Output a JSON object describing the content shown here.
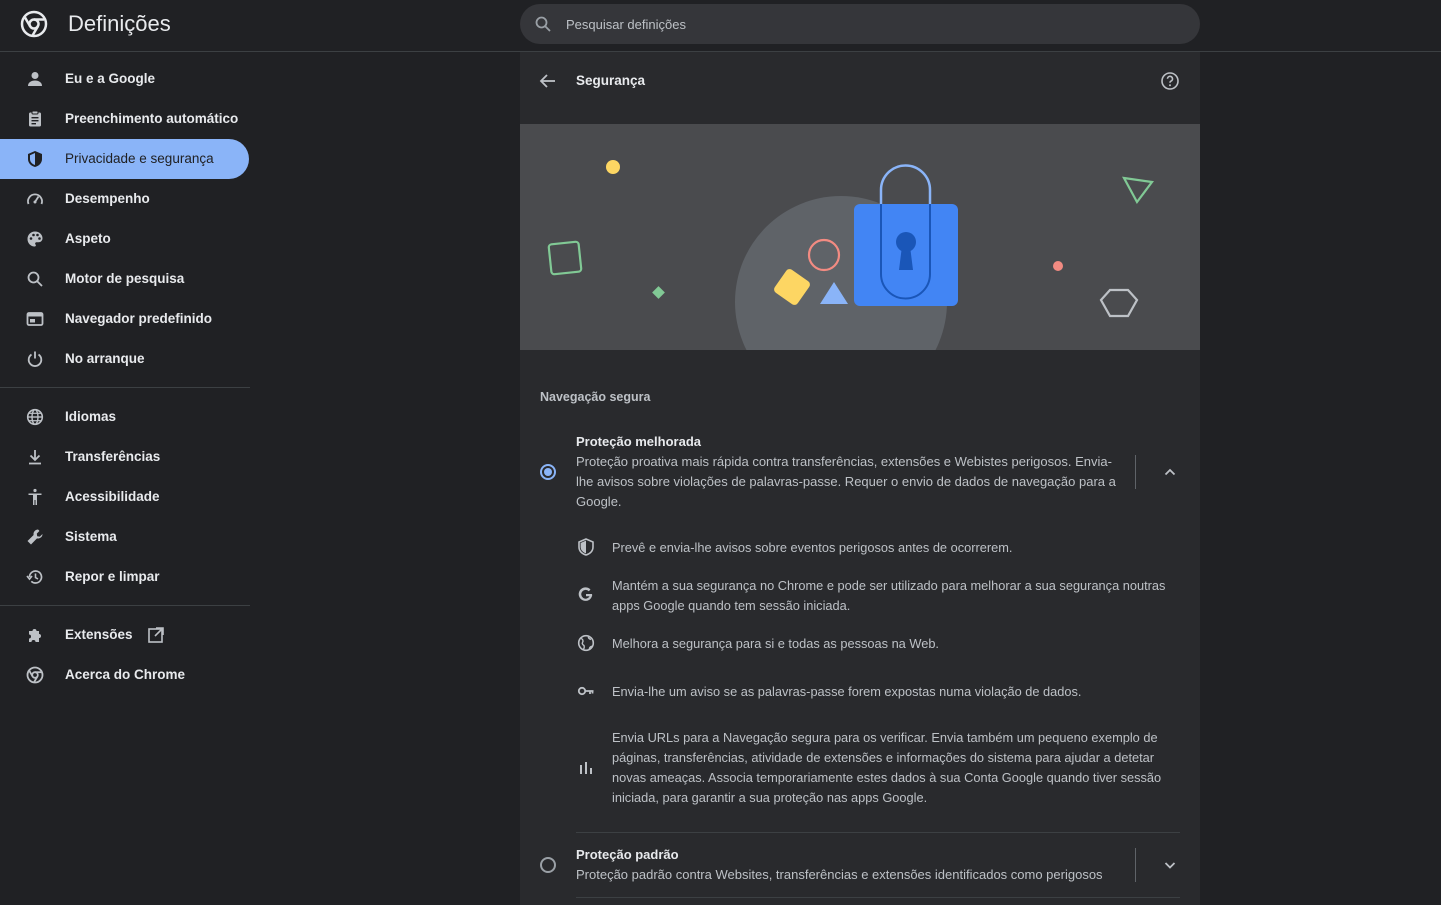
{
  "app": {
    "title": "Definições"
  },
  "search": {
    "placeholder": "Pesquisar definições"
  },
  "sidebar": {
    "group1": [
      {
        "label": "Eu e a Google",
        "icon": "person-icon"
      },
      {
        "label": "Preenchimento automático",
        "icon": "clipboard-icon"
      },
      {
        "label": "Privacidade e segurança",
        "icon": "shield-icon",
        "active": true
      },
      {
        "label": "Desempenho",
        "icon": "speedometer-icon"
      },
      {
        "label": "Aspeto",
        "icon": "palette-icon"
      },
      {
        "label": "Motor de pesquisa",
        "icon": "search-icon"
      },
      {
        "label": "Navegador predefinido",
        "icon": "browser-icon"
      },
      {
        "label": "No arranque",
        "icon": "power-icon"
      }
    ],
    "group2": [
      {
        "label": "Idiomas",
        "icon": "globe-icon"
      },
      {
        "label": "Transferências",
        "icon": "download-icon"
      },
      {
        "label": "Acessibilidade",
        "icon": "accessibility-icon"
      },
      {
        "label": "Sistema",
        "icon": "wrench-icon"
      },
      {
        "label": "Repor e limpar",
        "icon": "history-icon"
      }
    ],
    "group3": [
      {
        "label": "Extensões",
        "icon": "puzzle-icon"
      },
      {
        "label": "Acerca do Chrome",
        "icon": "chrome-icon"
      }
    ]
  },
  "page": {
    "title": "Segurança"
  },
  "safe_browsing": {
    "section_label": "Navegação segura",
    "enhanced": {
      "title": "Proteção melhorada",
      "description_lines": [
        "Proteção proativa mais rápida contra transferências, extensões e Webistes perigosos. Envia-",
        "lhe avisos sobre violações de palavras-passe. Requer o envio de dados de navegação para a",
        "Google."
      ],
      "selected": true,
      "expanded": true,
      "details": [
        {
          "icon": "shield-icon",
          "lines": [
            "Prevê e envia-lhe avisos sobre eventos perigosos antes de ocorrerem."
          ]
        },
        {
          "icon": "google-g-icon",
          "lines": [
            "Mantém a sua segurança no Chrome e pode ser utilizado para melhorar a sua segurança noutras",
            "apps Google quando tem sessão iniciada."
          ]
        },
        {
          "icon": "globe-icon",
          "lines": [
            "Melhora a segurança para si e todas as pessoas na Web."
          ]
        },
        {
          "icon": "key-icon",
          "lines": [
            "Envia-lhe um aviso se as palavras-passe forem expostas numa violação de dados."
          ]
        },
        {
          "icon": "bar-chart-icon",
          "lines": [
            "Envia URLs para a Navegação segura para os verificar. Envia também um pequeno exemplo de",
            "páginas, transferências, atividade de extensões e informações do sistema para ajudar a detetar",
            "novas ameaças. Associa temporariamente estes dados à sua Conta Google quando tiver sessão",
            "iniciada, para garantir a sua proteção nas apps Google."
          ]
        }
      ]
    },
    "standard": {
      "title": "Proteção padrão",
      "description_lines": [
        "Proteção padrão contra Websites, transferências e extensões identificados como perigosos"
      ],
      "selected": false,
      "expanded": false
    }
  },
  "colors": {
    "accent": "#8ab4f8",
    "background": "#202124",
    "card": "#292a2d",
    "lock": "#4285f4"
  }
}
